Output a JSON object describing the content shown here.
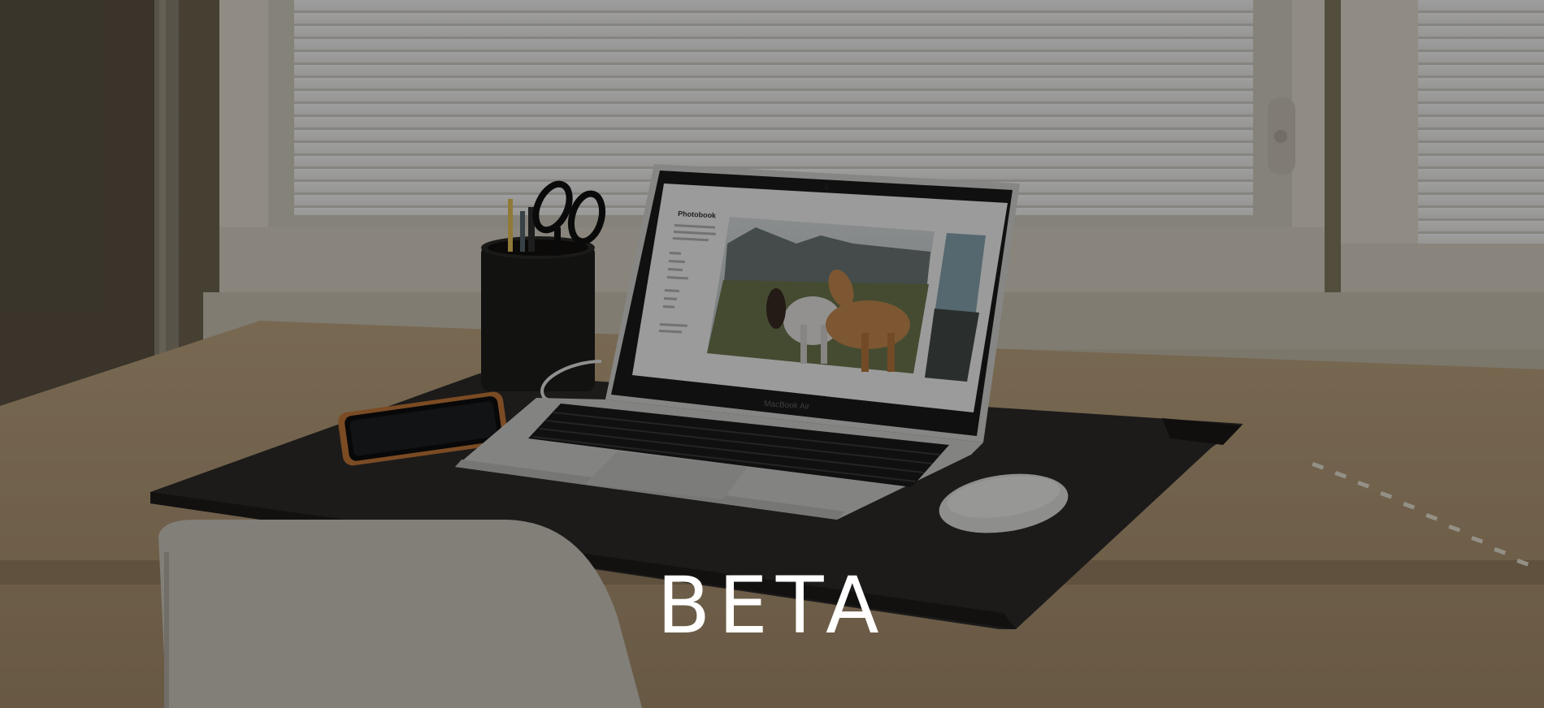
{
  "hero": {
    "badge_text": "BETA",
    "laptop_brand": "MacBook Air",
    "screen_site_title": "Photobook",
    "colors": {
      "overlay": "#000000",
      "badge_text": "#ffffff",
      "desk_surface": "#b89f7d",
      "desk_mat": "#2c2a28"
    }
  }
}
